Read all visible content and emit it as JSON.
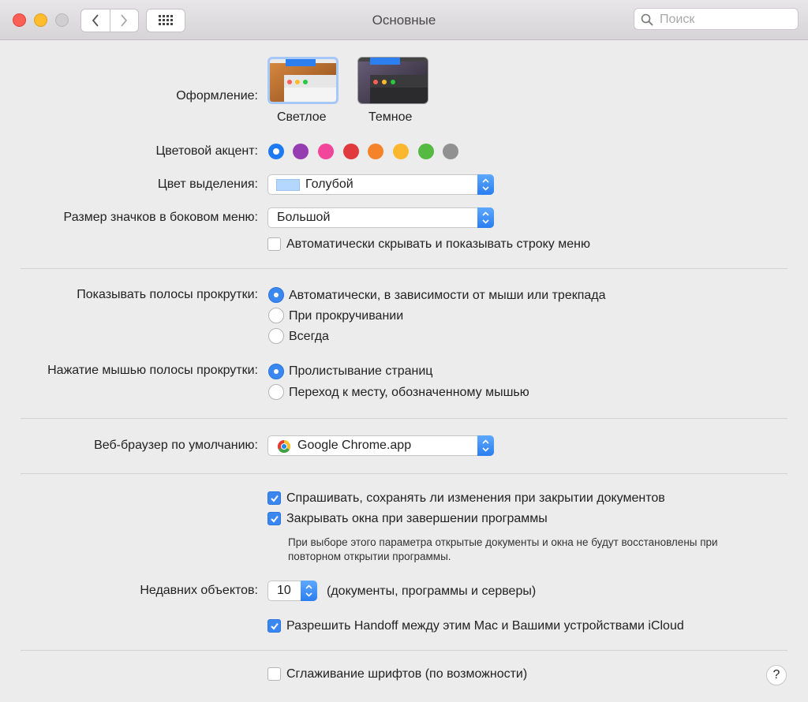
{
  "window": {
    "title": "Основные"
  },
  "search": {
    "placeholder": "Поиск"
  },
  "appearance": {
    "label": "Оформление:",
    "options": [
      {
        "label": "Светлое",
        "selected": true
      },
      {
        "label": "Темное",
        "selected": false
      }
    ]
  },
  "accent": {
    "label": "Цветовой акцент:",
    "colors": [
      "#1d7af0",
      "#953db1",
      "#f2469a",
      "#e03a3e",
      "#f4832a",
      "#fbb82e",
      "#56b941",
      "#919191"
    ],
    "selected_index": 0
  },
  "highlight": {
    "label": "Цвет выделения:",
    "value": "Голубой",
    "swatch": "#b3d7ff"
  },
  "sidebar_icons": {
    "label": "Размер значков в боковом меню:",
    "value": "Большой"
  },
  "menubar": {
    "label": "Автоматически скрывать и показывать строку меню",
    "checked": false
  },
  "scrollbars": {
    "label": "Показывать полосы прокрутки:",
    "options": [
      "Автоматически, в зависимости от мыши или трекпада",
      "При прокручивании",
      "Всегда"
    ],
    "selected_index": 0
  },
  "scroll_click": {
    "label": "Нажатие мышью полосы прокрутки:",
    "options": [
      "Пролистывание страниц",
      "Переход к месту, обозначенному мышью"
    ],
    "selected_index": 0
  },
  "browser": {
    "label": "Веб-браузер по умолчанию:",
    "value": "Google Chrome.app"
  },
  "ask_save": {
    "label": "Спрашивать, сохранять ли изменения при закрытии документов",
    "checked": true
  },
  "close_windows": {
    "label": "Закрывать окна при завершении программы",
    "checked": true
  },
  "close_note": {
    "line1": "При выборе этого параметра открытые документы и окна не будут восстановлены при",
    "line2": "повторном открытии программы."
  },
  "recent": {
    "label": "Недавних объектов:",
    "value": "10",
    "suffix": "(документы, программы и серверы)"
  },
  "handoff": {
    "label": "Разрешить Handoff между этим Mac и Вашими устройствами iCloud",
    "checked": true
  },
  "font_smoothing": {
    "label": "Сглаживание шрифтов (по возможности)",
    "checked": false
  },
  "help": {
    "label": "?"
  }
}
